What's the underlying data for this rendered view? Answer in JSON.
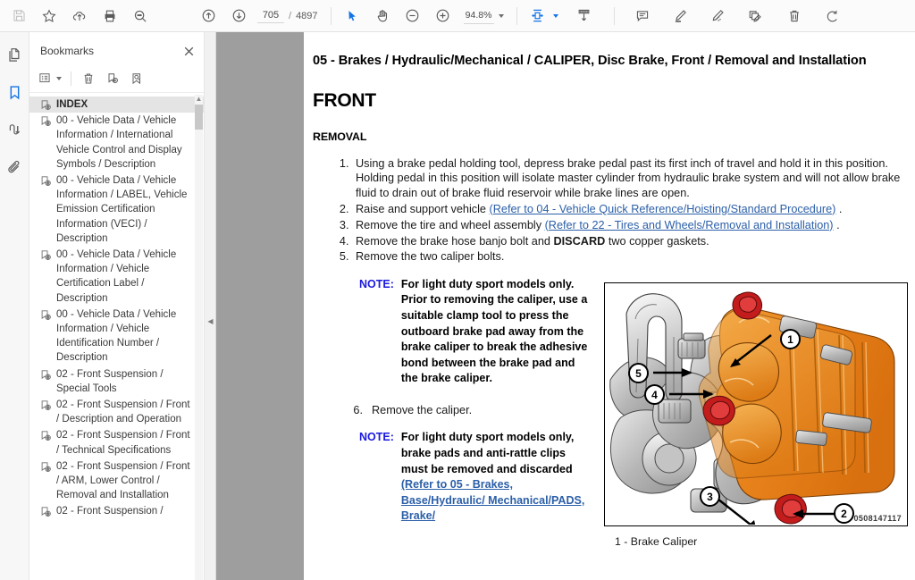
{
  "toolbar": {
    "left_tools": [
      {
        "name": "save-button",
        "icon": "save-icon",
        "disabled": true
      },
      {
        "name": "add-bookmark-star-button",
        "icon": "star-icon",
        "disabled": false
      },
      {
        "name": "upload-cloud-button",
        "icon": "cloud-upload-icon",
        "disabled": false
      },
      {
        "name": "print-button",
        "icon": "printer-icon",
        "disabled": false
      },
      {
        "name": "search-button",
        "icon": "search-icon",
        "disabled": false
      }
    ],
    "page_up_label": "previous-page",
    "page_down_label": "next-page",
    "current_page": "705",
    "page_separator": "/",
    "total_pages": "4897",
    "zoom_level": "94.8%",
    "right_tools": [
      {
        "name": "comment-button",
        "icon": "comment-icon"
      },
      {
        "name": "highlight-button",
        "icon": "highlighter-icon"
      },
      {
        "name": "draw-button",
        "icon": "pen-draw-icon"
      },
      {
        "name": "stamp-button",
        "icon": "stamp-icon"
      },
      {
        "name": "delete-button",
        "icon": "trash-icon"
      },
      {
        "name": "undo-button",
        "icon": "undo-rotate-icon"
      }
    ]
  },
  "rail": {
    "items": [
      {
        "name": "sidebar-page-thumbnails",
        "icon": "pages-icon",
        "active": false
      },
      {
        "name": "sidebar-bookmarks",
        "icon": "bookmark-icon",
        "active": true
      },
      {
        "name": "sidebar-signature",
        "icon": "signature-icon",
        "active": false
      },
      {
        "name": "sidebar-attachments",
        "icon": "paperclip-icon",
        "active": false
      }
    ]
  },
  "bookmarks": {
    "title": "Bookmarks",
    "tools": [
      {
        "name": "bookmark-options-button",
        "icon": "list-options-icon"
      },
      {
        "name": "delete-bookmark-button",
        "icon": "trash-icon"
      },
      {
        "name": "add-bookmark-button",
        "icon": "bookmark-plus-icon"
      },
      {
        "name": "find-bookmark-button",
        "icon": "bookmark-search-icon"
      }
    ],
    "items": [
      {
        "label": "INDEX",
        "selected": true
      },
      {
        "label": "00 - Vehicle Data / Vehicle Information / International Vehicle Control and Display Symbols / Description",
        "selected": false
      },
      {
        "label": "00 - Vehicle Data / Vehicle Information / LABEL, Vehicle Emission Certification Information (VECI) / Description",
        "selected": false
      },
      {
        "label": "00 - Vehicle Data / Vehicle Information / Vehicle Certification Label / Description",
        "selected": false
      },
      {
        "label": "00 - Vehicle Data / Vehicle Information / Vehicle Identification Number / Description",
        "selected": false
      },
      {
        "label": "02 - Front Suspension / Special Tools",
        "selected": false
      },
      {
        "label": "02 - Front Suspension / Front / Description and Operation",
        "selected": false
      },
      {
        "label": "02 - Front Suspension / Front / Technical Specifications",
        "selected": false
      },
      {
        "label": "02 - Front Suspension / Front / ARM, Lower Control / Removal and Installation",
        "selected": false
      },
      {
        "label": "02 - Front Suspension /",
        "selected": false
      }
    ]
  },
  "document": {
    "heading": "05 - Brakes / Hydraulic/Mechanical / CALIPER, Disc Brake, Front / Removal and Installation",
    "section_title": "FRONT",
    "subsection_title": "REMOVAL",
    "steps": [
      {
        "num": "1.",
        "parts": [
          {
            "type": "text",
            "text": "Using a brake pedal holding tool, depress brake pedal past its first inch of travel and hold it in this position. Holding pedal in this position will isolate master cylinder from hydraulic brake system and will not allow brake fluid to drain out of brake fluid reservoir while brake lines are open."
          }
        ]
      },
      {
        "num": "2.",
        "parts": [
          {
            "type": "text",
            "text": "Raise and support vehicle "
          },
          {
            "type": "link",
            "text": "(Refer to 04 - Vehicle Quick Reference/Hoisting/Standard Procedure)"
          },
          {
            "type": "text",
            "text": " ."
          }
        ]
      },
      {
        "num": "3.",
        "parts": [
          {
            "type": "text",
            "text": "Remove the tire and wheel assembly "
          },
          {
            "type": "link",
            "text": "(Refer to 22 - Tires and Wheels/Removal and Installation)"
          },
          {
            "type": "text",
            "text": " ."
          }
        ]
      },
      {
        "num": "4.",
        "parts": [
          {
            "type": "text",
            "text": "Remove the brake hose banjo bolt and "
          },
          {
            "type": "bold",
            "text": "DISCARD"
          },
          {
            "type": "text",
            "text": " two copper gaskets."
          }
        ]
      },
      {
        "num": "5.",
        "parts": [
          {
            "type": "text",
            "text": "Remove the two caliper bolts."
          }
        ]
      }
    ],
    "note1": {
      "label": "NOTE:",
      "text": "For light duty sport models only. Prior to removing the caliper, use a suitable clamp tool to press the outboard brake pad away from the brake caliper to break the adhesive bond between the brake pad and the brake caliper."
    },
    "step6": {
      "num": "6.",
      "text": "Remove the caliper."
    },
    "note2": {
      "label": "NOTE:",
      "text_before": "For light duty sport models only, brake pads and anti-rattle clips must be removed and discarded ",
      "link_text": "(Refer to 05 - Brakes, Base/Hydraulic/ Mechanical/PADS, Brake/"
    },
    "figure": {
      "id_code": "0508147117",
      "caption": "1 - Brake Caliper",
      "callouts": [
        "1",
        "2",
        "3",
        "4",
        "5"
      ],
      "alt": "Front disc brake caliper assembly exploded view"
    }
  },
  "colors": {
    "accent": "#1473e6",
    "link": "#2b5fa8",
    "note_label": "#1a1ae0",
    "caliper_orange": "#e8912a",
    "bolt_red": "#b81f1f",
    "page_backdrop": "#9e9e9e"
  }
}
